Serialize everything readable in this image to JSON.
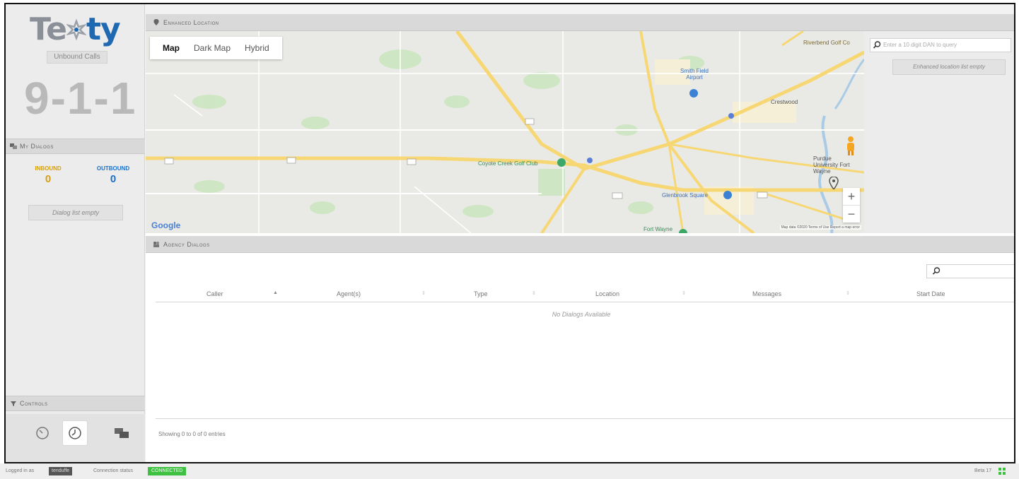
{
  "app": {
    "logo_pre": "Te",
    "logo_post": "ty",
    "unbound_label": "Unbound Calls",
    "emergency_number": "9-1-1"
  },
  "my_dialogs": {
    "title": "My Dialogs",
    "inbound_label": "INBOUND",
    "inbound_count": "0",
    "outbound_label": "OUTBOUND",
    "outbound_count": "0",
    "empty_text": "Dialog list empty"
  },
  "controls": {
    "title": "Controls",
    "buttons": [
      {
        "icon": "gauge-icon",
        "active": false
      },
      {
        "icon": "clock-icon",
        "active": true
      },
      {
        "icon": "chat-bubbles-icon",
        "active": false
      }
    ]
  },
  "enhanced_location": {
    "title": "Enhanced Location",
    "map_types": [
      "Map",
      "Dark Map",
      "Hybrid"
    ],
    "selected_map_type": "Map",
    "search_placeholder": "Enter a 10 digit DAN to query",
    "empty_text": "Enhanced location list empty",
    "google_logo": "Google",
    "attribution": "Map data ©2020   Terms of Use   Report a map error",
    "zoom_in": "+",
    "zoom_out": "−",
    "labels": {
      "golf_1": "Riverbend Golf Co",
      "airport": "Smith Field Airport",
      "crestwood": "Crestwood",
      "coyote": "Coyote Creek Golf Club",
      "glenbrook": "Glenbrook Square",
      "purdue": "Purdue University Fort Wayne",
      "fort_wayne": "Fort Wayne"
    }
  },
  "agency_dialogs": {
    "title": "Agency Dialogs",
    "columns": [
      "Caller",
      "Agent(s)",
      "Type",
      "Location",
      "Messages",
      "Start Date"
    ],
    "empty_text": "No Dialogs Available",
    "footer": "Showing 0 to 0 of 0 entries"
  },
  "status_bar": {
    "logged_in_label": "Logged in as",
    "user": "tenduffe",
    "connection_label": "Connection status",
    "connection_status": "CONNECTED",
    "right_text": "Beta 17"
  },
  "colors": {
    "brand_blue": "#1f68b2",
    "inbound": "#d4a017",
    "outbound": "#1f6fc8",
    "connected": "#3ec040"
  }
}
